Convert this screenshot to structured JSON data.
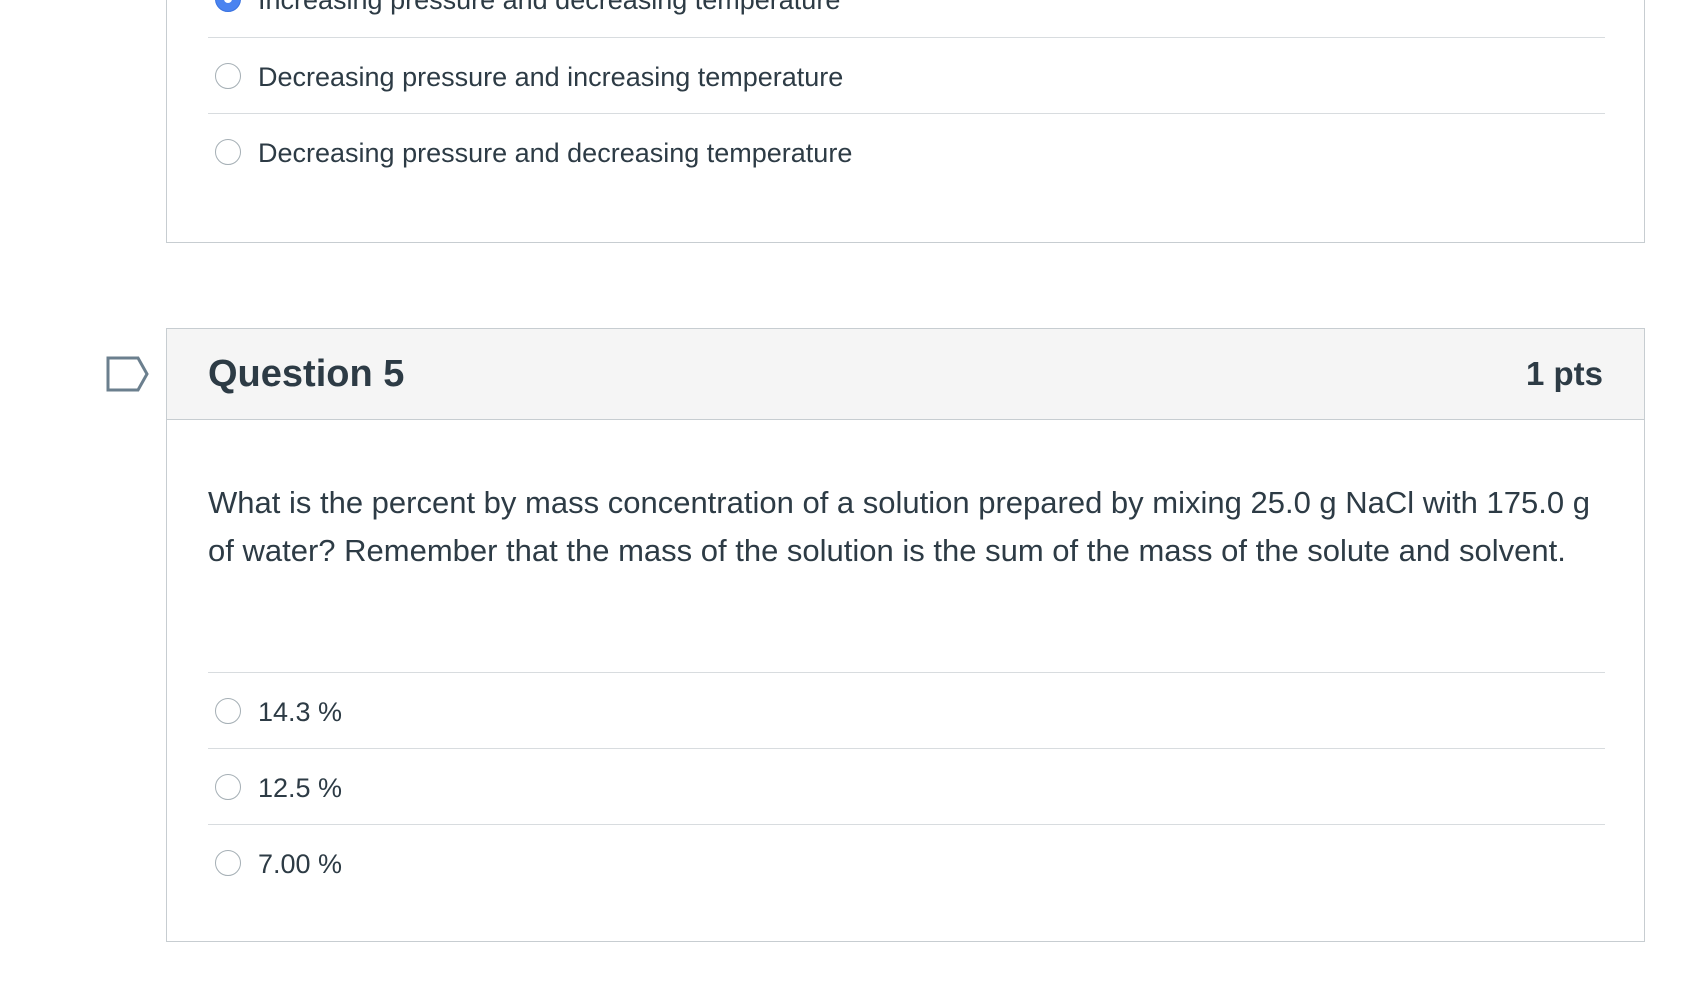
{
  "previous_question": {
    "answers": [
      {
        "label": "Increasing pressure and decreasing temperature",
        "selected": true
      },
      {
        "label": "Decreasing pressure and increasing temperature",
        "selected": false
      },
      {
        "label": "Decreasing pressure and decreasing temperature",
        "selected": false
      }
    ]
  },
  "question5": {
    "title": "Question 5",
    "points": "1 pts",
    "text": "What is the percent by mass concentration of a solution prepared by mixing 25.0 g NaCl with 175.0 g of water?  Remember that the mass of the solution is the sum of the mass of the solute and solvent.",
    "answers": [
      {
        "label": "14.3 %",
        "selected": false
      },
      {
        "label": "12.5 %",
        "selected": false
      },
      {
        "label": "7.00 %",
        "selected": false
      }
    ]
  },
  "icons": {
    "flag": "flag-question-icon",
    "radio": "radio-button-icon"
  },
  "colors": {
    "accent": "#4a83f0",
    "text": "#2d3b45",
    "border": "#c7cdd1",
    "header_bg": "#f5f5f5"
  }
}
